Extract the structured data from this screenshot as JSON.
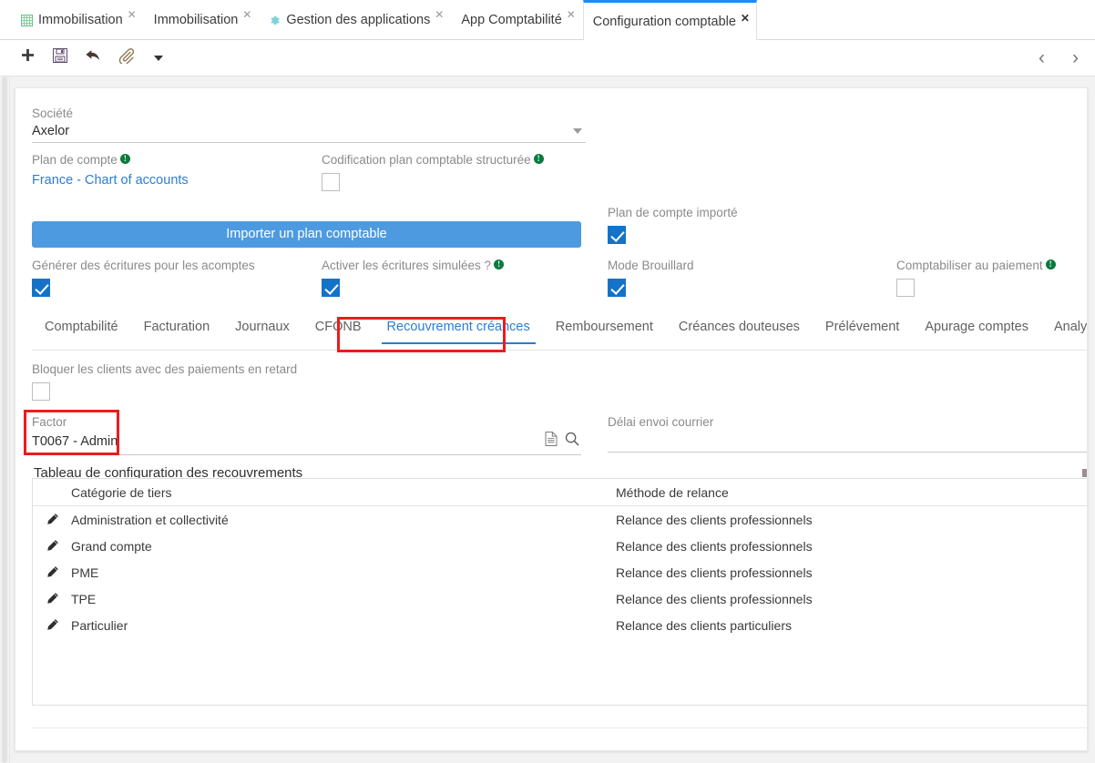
{
  "browser_tabs": [
    {
      "label": "Immobilisation",
      "icon": "grid-icon",
      "active": false
    },
    {
      "label": "Immobilisation",
      "icon": "none",
      "active": false
    },
    {
      "label": "Gestion des applications",
      "icon": "gear-icon",
      "active": false
    },
    {
      "label": "App Comptabilité",
      "icon": "none",
      "active": false
    },
    {
      "label": "Configuration comptable",
      "icon": "none",
      "active": true
    }
  ],
  "toolbar": {
    "new_label": "+",
    "icons": [
      "plus-icon",
      "save-icon",
      "undo-icon",
      "attachment-icon",
      "more-caret-icon"
    ],
    "prev_label": "‹",
    "next_label": "›"
  },
  "form": {
    "societe": {
      "label": "Société",
      "value": "Axelor"
    },
    "plan_de_compte": {
      "label": "Plan de compte",
      "value": "France - Chart of accounts",
      "has_info": true
    },
    "codification": {
      "label": "Codification plan comptable structurée",
      "checked": false,
      "has_info": true
    },
    "import_button": {
      "label": "Importer un plan comptable"
    },
    "plan_importe": {
      "label": "Plan de compte importé",
      "checked": true
    },
    "generer_acomptes": {
      "label": "Générer des écritures pour les acomptes",
      "checked": true
    },
    "ecritures_simulees": {
      "label": "Activer les écritures simulées ?",
      "checked": true,
      "has_info": true
    },
    "mode_brouillard": {
      "label": "Mode Brouillard",
      "checked": true
    },
    "comptabiliser_paiement": {
      "label": "Comptabiliser au paiement",
      "checked": false,
      "has_info": true
    }
  },
  "inner_tabs": [
    {
      "label": "Comptabilité",
      "active": false
    },
    {
      "label": "Facturation",
      "active": false
    },
    {
      "label": "Journaux",
      "active": false
    },
    {
      "label": "CFONB",
      "active": false
    },
    {
      "label": "Recouvrement créances",
      "active": true
    },
    {
      "label": "Remboursement",
      "active": false
    },
    {
      "label": "Créances douteuses",
      "active": false
    },
    {
      "label": "Prélévement",
      "active": false
    },
    {
      "label": "Apurage comptes",
      "active": false
    },
    {
      "label": "Analytique",
      "active": false
    }
  ],
  "panel": {
    "bloquer_clients": {
      "label": "Bloquer les clients avec des paiements en retard",
      "checked": false
    },
    "factor": {
      "label": "Factor",
      "value": "T0067 - Admin",
      "icons": [
        "document-icon",
        "search-icon"
      ]
    },
    "delai_envoi": {
      "label": "Délai envoi courrier",
      "value": ""
    },
    "grid_title": "Tableau de configuration des recouvrements"
  },
  "grid": {
    "columns": [
      "Catégorie de tiers",
      "Méthode de relance"
    ],
    "rows": [
      {
        "categorie": "Administration et collectivité",
        "methode": "Relance des clients professionnels"
      },
      {
        "categorie": "Grand compte",
        "methode": "Relance des clients professionnels"
      },
      {
        "categorie": "PME",
        "methode": "Relance des clients professionnels"
      },
      {
        "categorie": "TPE",
        "methode": "Relance des clients professionnels"
      },
      {
        "categorie": "Particulier",
        "methode": "Relance des clients particuliers"
      }
    ]
  },
  "colors": {
    "accent_blue": "#2d7dd2",
    "button_blue": "#4e9ae0",
    "checkbox_blue": "#1473c8",
    "annotation_red": "#ee1b1b",
    "info_green": "#0a7a3d"
  }
}
